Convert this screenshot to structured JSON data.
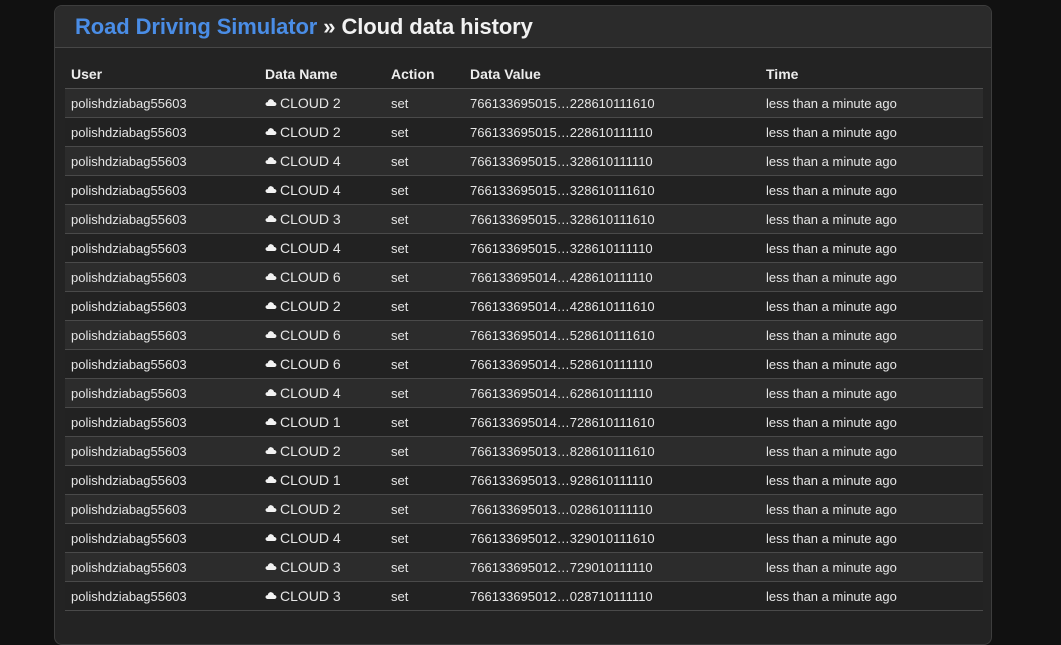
{
  "header": {
    "project_title": "Road Driving Simulator",
    "separator": " » ",
    "page_title": "Cloud data history"
  },
  "table": {
    "columns": [
      "User",
      "Data Name",
      "Action",
      "Data Value",
      "Time"
    ],
    "icon": "cloud-icon",
    "rows": [
      {
        "user": "polishdziabag55603",
        "name": "CLOUD 2",
        "action": "set",
        "value": "766133695015…228610111610",
        "time": "less than a minute ago"
      },
      {
        "user": "polishdziabag55603",
        "name": "CLOUD 2",
        "action": "set",
        "value": "766133695015…228610111110",
        "time": "less than a minute ago"
      },
      {
        "user": "polishdziabag55603",
        "name": "CLOUD 4",
        "action": "set",
        "value": "766133695015…328610111110",
        "time": "less than a minute ago"
      },
      {
        "user": "polishdziabag55603",
        "name": "CLOUD 4",
        "action": "set",
        "value": "766133695015…328610111610",
        "time": "less than a minute ago"
      },
      {
        "user": "polishdziabag55603",
        "name": "CLOUD 3",
        "action": "set",
        "value": "766133695015…328610111610",
        "time": "less than a minute ago"
      },
      {
        "user": "polishdziabag55603",
        "name": "CLOUD 4",
        "action": "set",
        "value": "766133695015…328610111110",
        "time": "less than a minute ago"
      },
      {
        "user": "polishdziabag55603",
        "name": "CLOUD 6",
        "action": "set",
        "value": "766133695014…428610111110",
        "time": "less than a minute ago"
      },
      {
        "user": "polishdziabag55603",
        "name": "CLOUD 2",
        "action": "set",
        "value": "766133695014…428610111610",
        "time": "less than a minute ago"
      },
      {
        "user": "polishdziabag55603",
        "name": "CLOUD 6",
        "action": "set",
        "value": "766133695014…528610111610",
        "time": "less than a minute ago"
      },
      {
        "user": "polishdziabag55603",
        "name": "CLOUD 6",
        "action": "set",
        "value": "766133695014…528610111110",
        "time": "less than a minute ago"
      },
      {
        "user": "polishdziabag55603",
        "name": "CLOUD 4",
        "action": "set",
        "value": "766133695014…628610111110",
        "time": "less than a minute ago"
      },
      {
        "user": "polishdziabag55603",
        "name": "CLOUD 1",
        "action": "set",
        "value": "766133695014…728610111610",
        "time": "less than a minute ago"
      },
      {
        "user": "polishdziabag55603",
        "name": "CLOUD 2",
        "action": "set",
        "value": "766133695013…828610111610",
        "time": "less than a minute ago"
      },
      {
        "user": "polishdziabag55603",
        "name": "CLOUD 1",
        "action": "set",
        "value": "766133695013…928610111110",
        "time": "less than a minute ago"
      },
      {
        "user": "polishdziabag55603",
        "name": "CLOUD 2",
        "action": "set",
        "value": "766133695013…028610111110",
        "time": "less than a minute ago"
      },
      {
        "user": "polishdziabag55603",
        "name": "CLOUD 4",
        "action": "set",
        "value": "766133695012…329010111610",
        "time": "less than a minute ago"
      },
      {
        "user": "polishdziabag55603",
        "name": "CLOUD 3",
        "action": "set",
        "value": "766133695012…729010111110",
        "time": "less than a minute ago"
      },
      {
        "user": "polishdziabag55603",
        "name": "CLOUD 3",
        "action": "set",
        "value": "766133695012…028710111110",
        "time": "less than a minute ago"
      }
    ]
  },
  "colors": {
    "background": "#111111",
    "panel": "#232323",
    "link": "#4a8de6",
    "text": "#e6e6e6"
  }
}
